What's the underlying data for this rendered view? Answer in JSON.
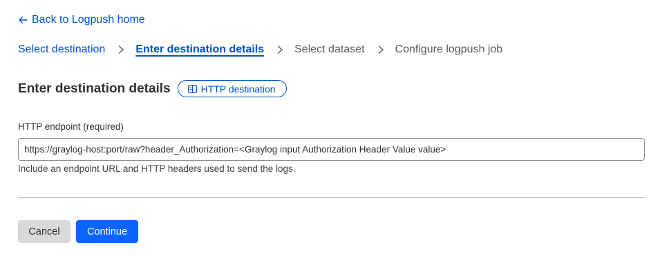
{
  "nav": {
    "back_label": "Back to Logpush home"
  },
  "steps": [
    {
      "label": "Select destination",
      "state": "done"
    },
    {
      "label": "Enter destination details",
      "state": "active"
    },
    {
      "label": "Select dataset",
      "state": "pending"
    },
    {
      "label": "Configure logpush job",
      "state": "pending"
    }
  ],
  "page": {
    "title": "Enter destination details",
    "badge_label": "HTTP destination",
    "badge_icon": "book-icon"
  },
  "form": {
    "endpoint_label": "HTTP endpoint (required)",
    "endpoint_value": "https://graylog-host:port/raw?header_Authorization=<Graylog input Authorization Header Value value>",
    "endpoint_help": "Include an endpoint URL and HTTP headers used to send the logs."
  },
  "actions": {
    "cancel_label": "Cancel",
    "continue_label": "Continue"
  },
  "colors": {
    "link": "#0051c3",
    "primary_button": "#0a64fe",
    "secondary_button": "#d9d9d9"
  }
}
